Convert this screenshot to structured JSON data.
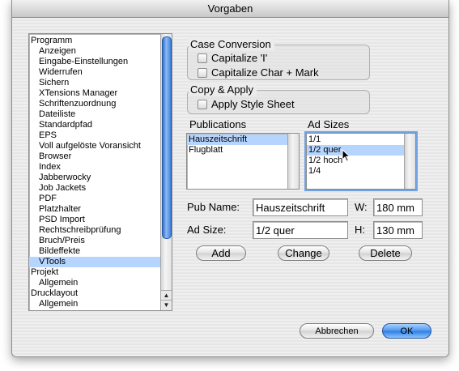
{
  "window": {
    "title": "Vorgaben"
  },
  "nav": {
    "items": [
      {
        "label": "Programm",
        "indent": 0
      },
      {
        "label": "Anzeigen",
        "indent": 1
      },
      {
        "label": "Eingabe-Einstellungen",
        "indent": 1
      },
      {
        "label": "Widerrufen",
        "indent": 1
      },
      {
        "label": "Sichern",
        "indent": 1
      },
      {
        "label": "XTensions Manager",
        "indent": 1
      },
      {
        "label": "Schriftenzuordnung",
        "indent": 1
      },
      {
        "label": "Dateiliste",
        "indent": 1
      },
      {
        "label": "Standardpfad",
        "indent": 1
      },
      {
        "label": "EPS",
        "indent": 1
      },
      {
        "label": "Voll aufgelöste Voransicht",
        "indent": 1
      },
      {
        "label": "Browser",
        "indent": 1
      },
      {
        "label": "Index",
        "indent": 1
      },
      {
        "label": "Jabberwocky",
        "indent": 1
      },
      {
        "label": "Job Jackets",
        "indent": 1
      },
      {
        "label": "PDF",
        "indent": 1
      },
      {
        "label": "Platzhalter",
        "indent": 1
      },
      {
        "label": "PSD Import",
        "indent": 1
      },
      {
        "label": "Rechtschreibprüfung",
        "indent": 1
      },
      {
        "label": "Bruch/Preis",
        "indent": 1
      },
      {
        "label": "Bildeffekte",
        "indent": 1
      },
      {
        "label": "VTools",
        "indent": 1,
        "selected": true
      },
      {
        "label": "Projekt",
        "indent": 0
      },
      {
        "label": "Allgemein",
        "indent": 1
      },
      {
        "label": "Drucklayout",
        "indent": 0
      },
      {
        "label": "Allgemein",
        "indent": 1
      }
    ]
  },
  "case_conversion": {
    "title": "Case Conversion",
    "capitalize_i": "Capitalize 'I'",
    "capitalize_char_mark": "Capitalize Char + Mark"
  },
  "copy_apply": {
    "title": "Copy & Apply",
    "apply_style_sheet": "Apply Style Sheet"
  },
  "publications": {
    "label": "Publications",
    "items": [
      {
        "label": "Hauszeitschrift",
        "selected": true
      },
      {
        "label": "Flugblatt"
      }
    ]
  },
  "ad_sizes": {
    "label": "Ad Sizes",
    "items": [
      {
        "label": "1/1"
      },
      {
        "label": "1/2 quer",
        "selected": true
      },
      {
        "label": "1/2 hoch"
      },
      {
        "label": "1/4"
      }
    ]
  },
  "form": {
    "pub_name_label": "Pub Name:",
    "pub_name_value": "Hauszeitschrift",
    "w_label": "W:",
    "w_value": "180 mm",
    "ad_size_label": "Ad Size:",
    "ad_size_value": "1/2 quer",
    "h_label": "H:",
    "h_value": "130 mm"
  },
  "buttons": {
    "add": "Add",
    "change": "Change",
    "delete": "Delete",
    "cancel": "Abbrechen",
    "ok": "OK"
  },
  "colors": {
    "selection": "#b5d5ff",
    "default_button": "#4f97ee"
  },
  "icons": {
    "cursor": "mouse-pointer-icon"
  }
}
